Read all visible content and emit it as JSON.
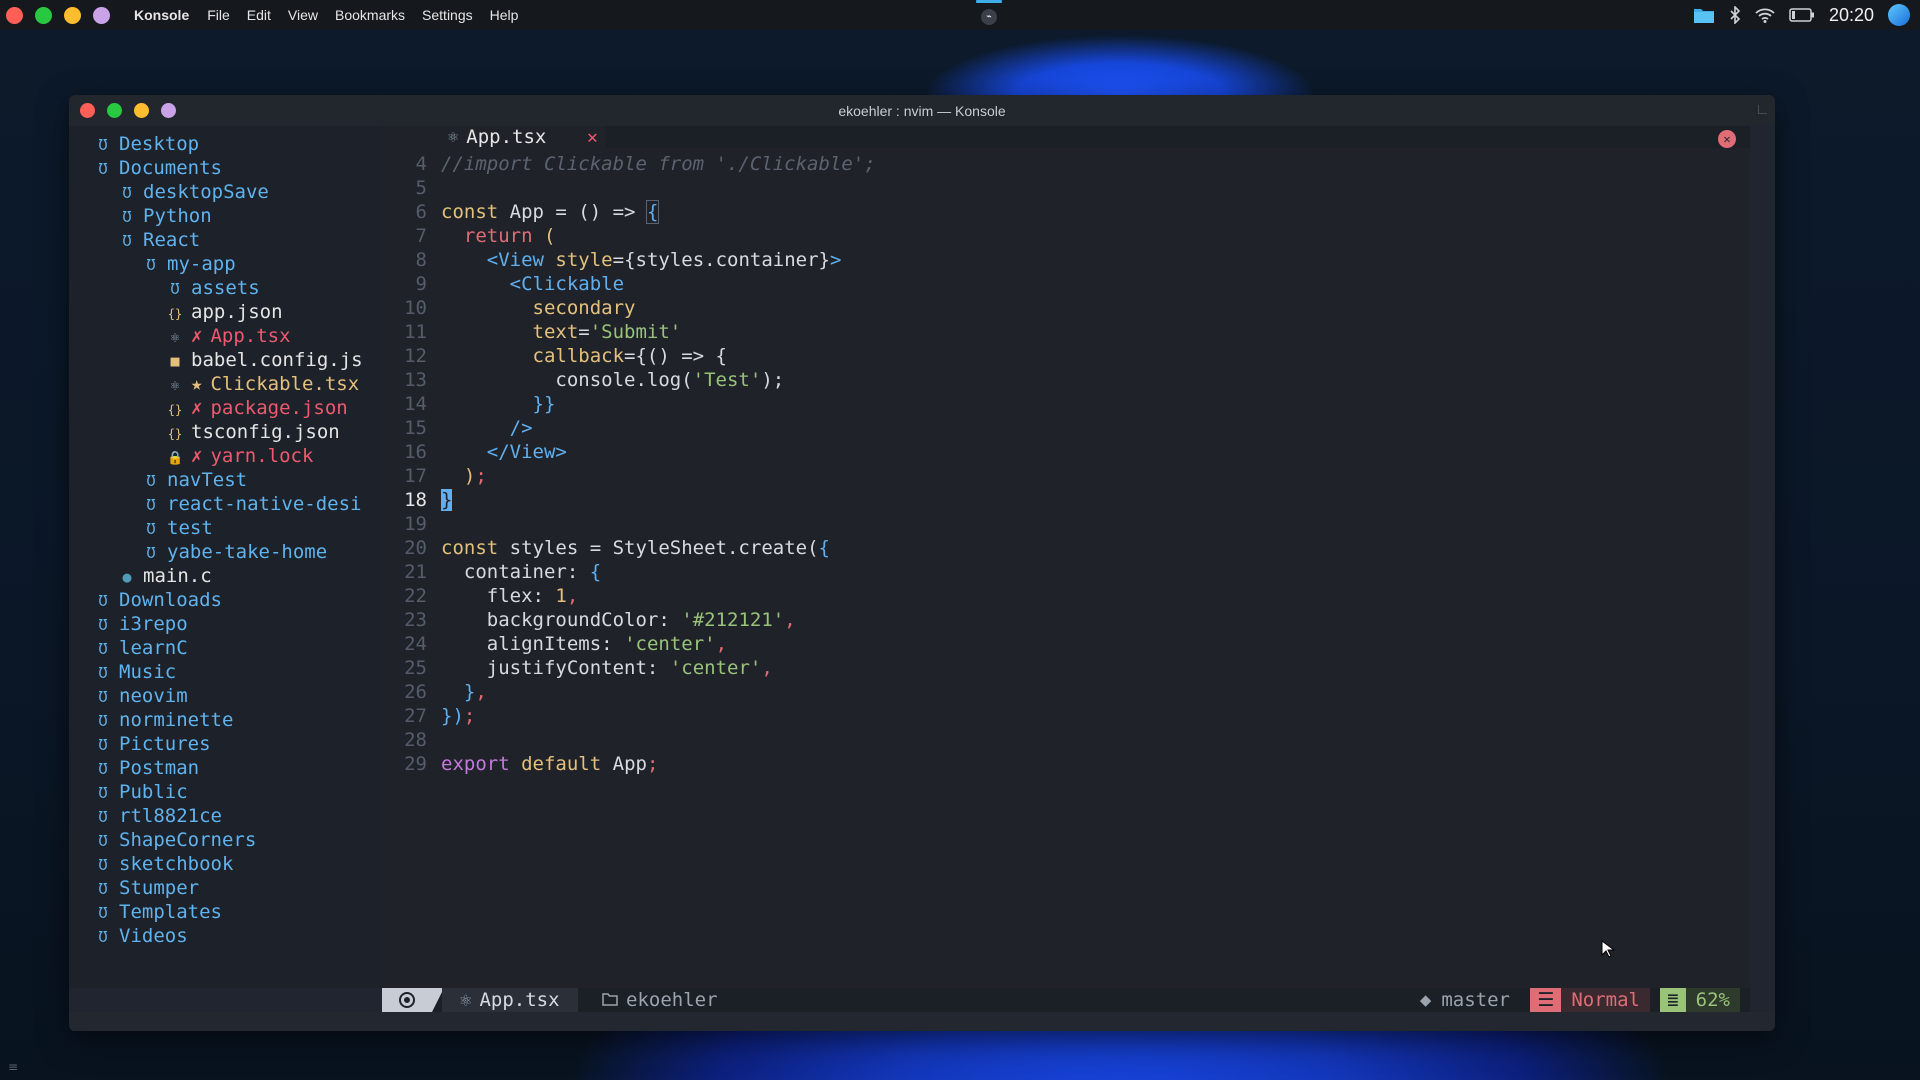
{
  "topbar": {
    "app_name": "Konsole",
    "menu": [
      "File",
      "Edit",
      "View",
      "Bookmarks",
      "Settings",
      "Help"
    ],
    "clock": "20:20",
    "dot_colors": [
      "#ff5f57",
      "#28c840",
      "#febc2e",
      "#c9a2e8"
    ]
  },
  "window": {
    "title": "ekoehler : nvim — Konsole"
  },
  "tree": [
    {
      "name": "Desktop",
      "type": "folder",
      "depth": 0
    },
    {
      "name": "Documents",
      "type": "folder",
      "depth": 0
    },
    {
      "name": "desktopSave",
      "type": "folder",
      "depth": 1
    },
    {
      "name": "Python",
      "type": "folder",
      "depth": 1
    },
    {
      "name": "React",
      "type": "folder",
      "depth": 1
    },
    {
      "name": "my-app",
      "type": "folder",
      "depth": 2
    },
    {
      "name": "assets",
      "type": "folder",
      "depth": 3
    },
    {
      "name": "app.json",
      "type": "json",
      "depth": 3
    },
    {
      "name": "App.tsx",
      "type": "react",
      "depth": 3,
      "flag": "✗",
      "state": "mod"
    },
    {
      "name": "babel.config.js",
      "type": "js",
      "depth": 3
    },
    {
      "name": "Clickable.tsx",
      "type": "react",
      "depth": 3,
      "flag": "★",
      "state": "star"
    },
    {
      "name": "package.json",
      "type": "json",
      "depth": 3,
      "flag": "✗",
      "state": "mod"
    },
    {
      "name": "tsconfig.json",
      "type": "json",
      "depth": 3
    },
    {
      "name": "yarn.lock",
      "type": "lock",
      "depth": 3,
      "flag": "✗",
      "state": "mod"
    },
    {
      "name": "navTest",
      "type": "folder",
      "depth": 2
    },
    {
      "name": "react-native-desi",
      "type": "folder",
      "depth": 2
    },
    {
      "name": "test",
      "type": "folder",
      "depth": 2
    },
    {
      "name": "yabe-take-home",
      "type": "folder",
      "depth": 2
    },
    {
      "name": "main.c",
      "type": "c",
      "depth": 1
    },
    {
      "name": "Downloads",
      "type": "folder",
      "depth": 0
    },
    {
      "name": "i3repo",
      "type": "folder",
      "depth": 0
    },
    {
      "name": "learnC",
      "type": "folder",
      "depth": 0
    },
    {
      "name": "Music",
      "type": "folder",
      "depth": 0
    },
    {
      "name": "neovim",
      "type": "folder",
      "depth": 0
    },
    {
      "name": "norminette",
      "type": "folder",
      "depth": 0
    },
    {
      "name": "Pictures",
      "type": "folder",
      "depth": 0
    },
    {
      "name": "Postman",
      "type": "folder",
      "depth": 0
    },
    {
      "name": "Public",
      "type": "folder",
      "depth": 0
    },
    {
      "name": "rtl8821ce",
      "type": "folder",
      "depth": 0
    },
    {
      "name": "ShapeCorners",
      "type": "folder",
      "depth": 0
    },
    {
      "name": "sketchbook",
      "type": "folder",
      "depth": 0
    },
    {
      "name": "Stumper",
      "type": "folder",
      "depth": 0
    },
    {
      "name": "Templates",
      "type": "folder",
      "depth": 0
    },
    {
      "name": "Videos",
      "type": "folder",
      "depth": 0
    }
  ],
  "editor": {
    "tab_name": "App.tsx",
    "tab_close": "✕",
    "current_line": 18,
    "lines": [
      {
        "n": 4,
        "html": "<span class='cm'>//import Clickable from './Clickable';</span>"
      },
      {
        "n": 5,
        "html": ""
      },
      {
        "n": 6,
        "html": "<span class='k'>const</span> <span class='id'>App</span> = () =&gt; <span class='brace'>{</span>"
      },
      {
        "n": 7,
        "html": "  <span class='rt'>return</span> <span class='k'>(</span>"
      },
      {
        "n": 8,
        "html": "    <span class='tg'>&lt;View</span> <span class='at'>style</span>=<span class='id'>{styles.container}</span><span class='tg'>&gt;</span>"
      },
      {
        "n": 9,
        "html": "      <span class='tg'>&lt;Clickable</span>"
      },
      {
        "n": 10,
        "html": "        <span class='at'>secondary</span>"
      },
      {
        "n": 11,
        "html": "        <span class='at'>text</span>=<span class='st'>'Submit'</span>"
      },
      {
        "n": 12,
        "html": "        <span class='at'>callback</span>=<span class='id'>{() =&gt; {</span>"
      },
      {
        "n": 13,
        "html": "          <span class='id'>console.log(</span><span class='st'>'Test'</span><span class='id'>);</span>"
      },
      {
        "n": 14,
        "html": "        <span class='pn'>}}</span>"
      },
      {
        "n": 15,
        "html": "      <span class='tg'>/&gt;</span>"
      },
      {
        "n": 16,
        "html": "    <span class='tg'>&lt;/View&gt;</span>"
      },
      {
        "n": 17,
        "html": "  <span class='k'>)</span><span class='sp'>;</span>"
      },
      {
        "n": 18,
        "html": "<span class='cursor'>}</span>"
      },
      {
        "n": 19,
        "html": ""
      },
      {
        "n": 20,
        "html": "<span class='k'>const</span> <span class='id'>styles = StyleSheet.create(</span><span class='pn'>{</span>"
      },
      {
        "n": 21,
        "html": "  <span class='id'>container:</span> <span class='pn'>{</span>"
      },
      {
        "n": 22,
        "html": "    <span class='id'>flex:</span> <span class='num'>1</span><span class='sp'>,</span>"
      },
      {
        "n": 23,
        "html": "    <span class='id'>backgroundColor:</span> <span class='st'>'#212121'</span><span class='sp'>,</span>"
      },
      {
        "n": 24,
        "html": "    <span class='id'>alignItems:</span> <span class='st'>'center'</span><span class='sp'>,</span>"
      },
      {
        "n": 25,
        "html": "    <span class='id'>justifyContent:</span> <span class='st'>'center'</span><span class='sp'>,</span>"
      },
      {
        "n": 26,
        "html": "  <span class='pn'>}</span><span class='sp'>,</span>"
      },
      {
        "n": 27,
        "html": "<span class='pn'>})</span><span class='sp'>;</span>"
      },
      {
        "n": 28,
        "html": ""
      },
      {
        "n": 29,
        "html": "<span class='kw'>export</span> <span class='k'>default</span> <span class='id'>App</span><span class='sp'>;</span>"
      }
    ]
  },
  "status": {
    "file": "App.tsx",
    "dir": "ekoehler",
    "branch": "master",
    "mode": "Normal",
    "percent": "62%"
  }
}
